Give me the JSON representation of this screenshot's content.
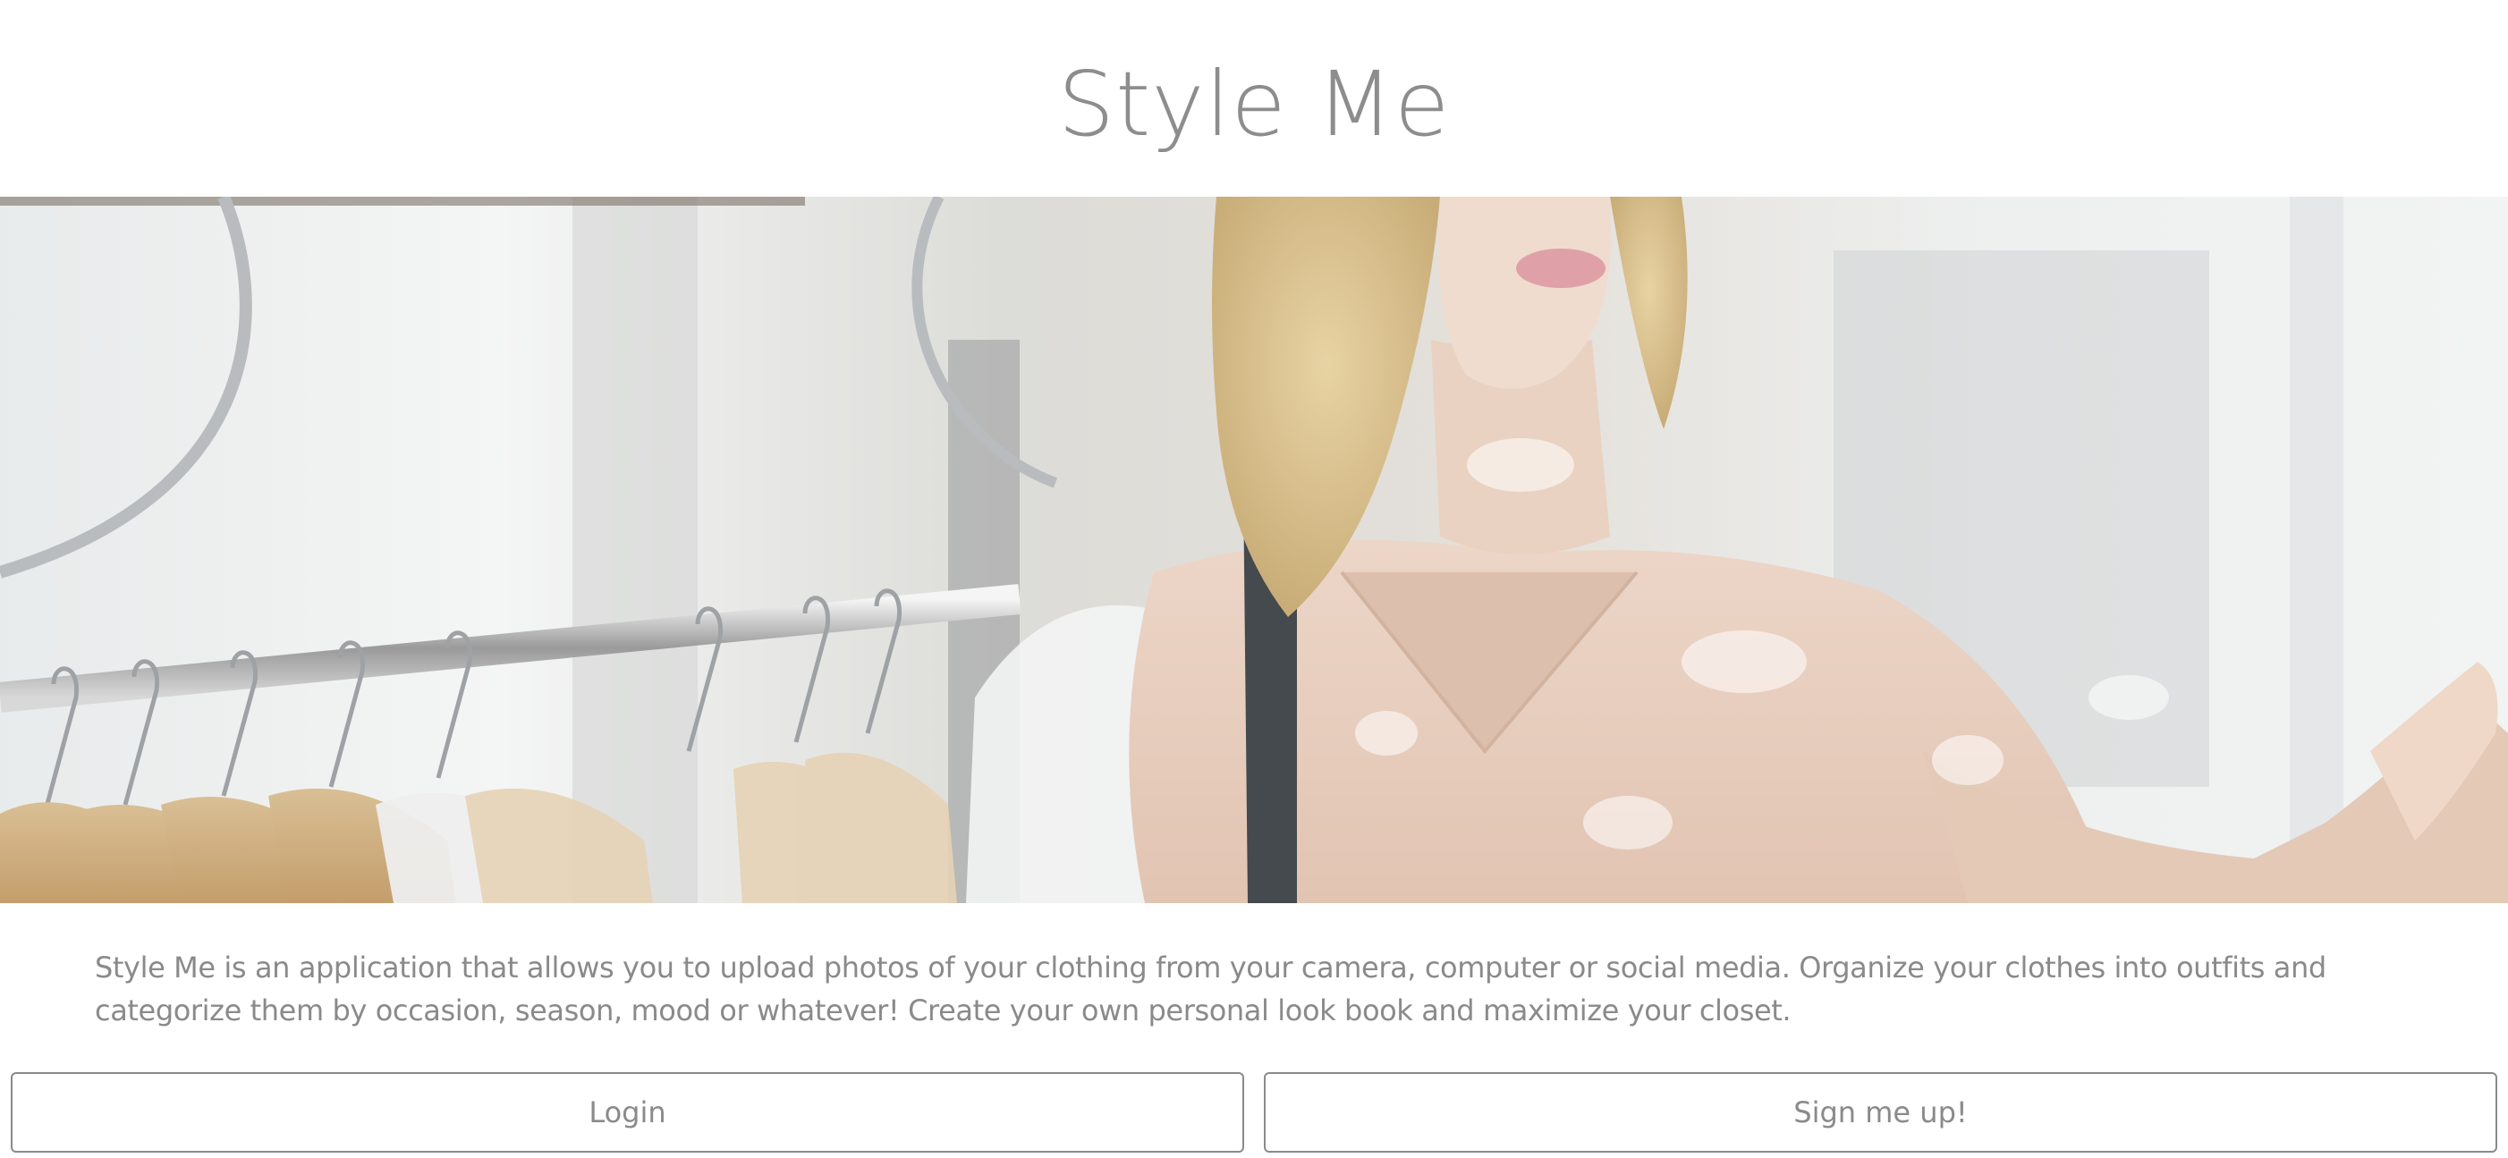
{
  "header": {
    "title": "Style Me"
  },
  "hero": {
    "image": "clothing-store-woman-photo"
  },
  "intro": {
    "text": "Style Me is an application that allows you to upload photos of your clothing from your camera, computer or social media. Organize your clothes into outfits and categorize them by occasion, season, mood or whatever! Create your own personal look book and maximize your closet."
  },
  "actions": {
    "login_label": "Login",
    "signup_label": "Sign me up!"
  },
  "colors": {
    "text": "#8a8a8a",
    "border": "#8a8a8a",
    "background": "#ffffff"
  }
}
